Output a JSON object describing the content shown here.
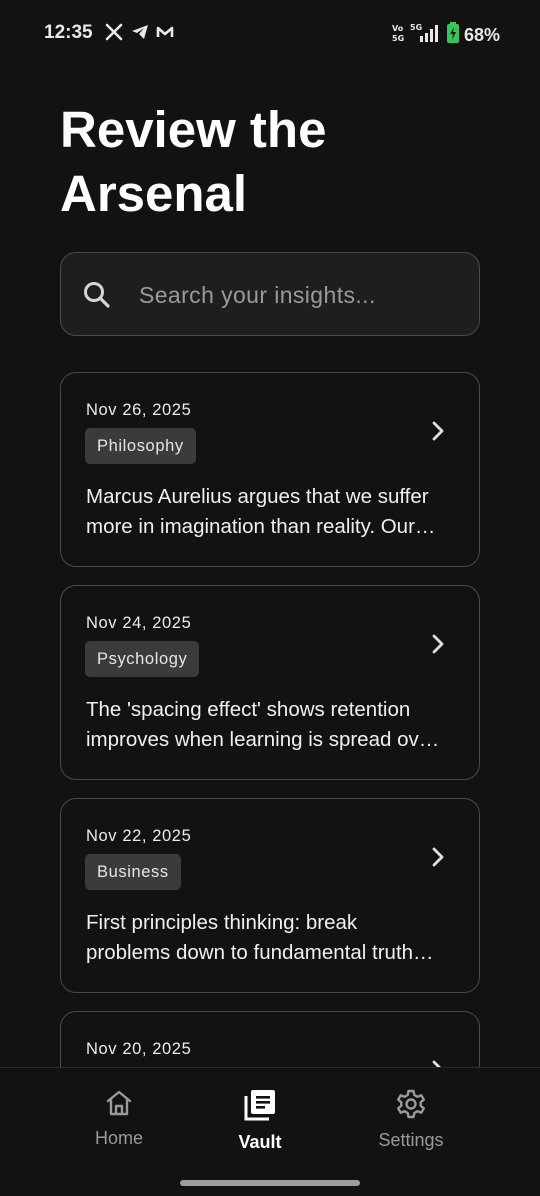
{
  "status_bar": {
    "time": "12:35",
    "notification_icons": [
      "x-icon",
      "telegram-icon",
      "m-icon"
    ],
    "network_label": "5G",
    "battery_percent": "68%"
  },
  "page": {
    "title": "Review the Arsenal"
  },
  "search": {
    "placeholder": "Search your insights...",
    "value": ""
  },
  "insights": [
    {
      "date": "Nov 26, 2025",
      "tag": "Philosophy",
      "line1": "Marcus Aurelius argues that we suffer",
      "line2": "more in imagination than reality. Our…"
    },
    {
      "date": "Nov 24, 2025",
      "tag": "Psychology",
      "line1": "The 'spacing effect' shows retention",
      "line2": "improves when learning is spread ov…"
    },
    {
      "date": "Nov 22, 2025",
      "tag": "Business",
      "line1": "First principles thinking: break",
      "line2": "problems down to fundamental truth…"
    },
    {
      "date": "Nov 20, 2025",
      "tag": "",
      "line1": "",
      "line2": ""
    }
  ],
  "nav": {
    "home": "Home",
    "vault": "Vault",
    "settings": "Settings",
    "active": "vault"
  },
  "colors": {
    "background": "#121212",
    "card_border": "#4a4a4a",
    "tag_bg": "#3b3b3b",
    "battery_green": "#34c759"
  }
}
